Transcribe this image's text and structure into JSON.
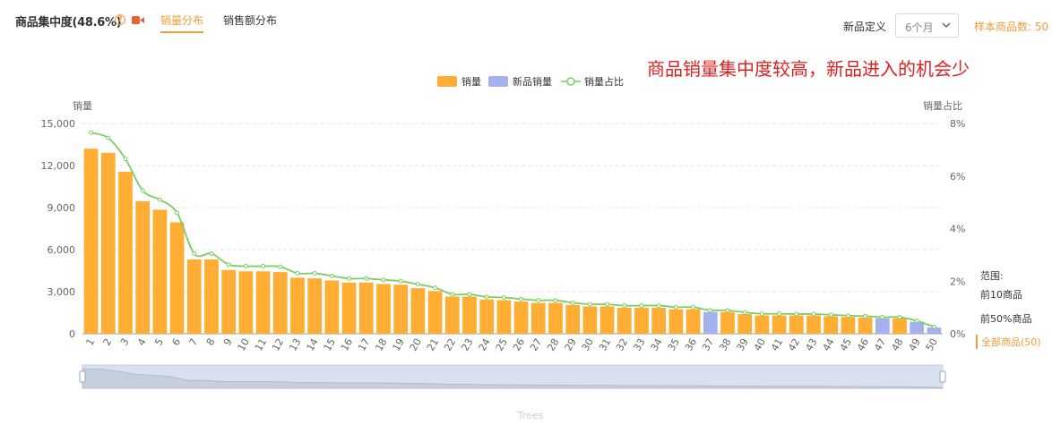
{
  "header": {
    "title": "商品集中度(48.6%)",
    "help_icon": "question-circle-icon",
    "video_icon": "video-camera-icon",
    "tabs": [
      {
        "label": "销量分布",
        "active": true
      },
      {
        "label": "销售额分布",
        "active": false
      }
    ]
  },
  "controls": {
    "new_product_label": "新品定义",
    "period_select": "6个月",
    "sample_count": "样本商品数: 50"
  },
  "annotation": "商品销量集中度较高，新品进入的机会少",
  "range_filter": {
    "title": "范围:",
    "options": [
      "前10商品",
      "前50%商品",
      "全部商品(50)"
    ],
    "selected": "全部商品(50)"
  },
  "colors": {
    "bar": "#ffad33",
    "new_bar": "#a5b0ee",
    "line": "#7ccd62",
    "accent": "#f29c38",
    "annotation": "#e02020"
  },
  "chart_data": {
    "type": "bar",
    "ylabel_left": "销量",
    "ylabel_right": "销量占比",
    "xlabel": "Trees",
    "ylim_left": [
      0,
      15000
    ],
    "yticks_left": [
      "15,000",
      "12,000",
      "9,000",
      "6,000",
      "3,000",
      "0"
    ],
    "ylim_right": [
      0,
      8
    ],
    "yticks_right": [
      "8%",
      "6%",
      "4%",
      "2%",
      "0%"
    ],
    "legend": [
      "销量",
      "新品销量",
      "销量占比"
    ],
    "legend_position": "top-center",
    "grid": true,
    "categories": [
      "1",
      "2",
      "3",
      "4",
      "5",
      "6",
      "7",
      "8",
      "9",
      "10",
      "11",
      "12",
      "13",
      "14",
      "15",
      "16",
      "17",
      "18",
      "19",
      "20",
      "21",
      "22",
      "23",
      "24",
      "25",
      "26",
      "27",
      "28",
      "29",
      "30",
      "31",
      "32",
      "33",
      "34",
      "35",
      "36",
      "37",
      "38",
      "39",
      "40",
      "41",
      "42",
      "43",
      "44",
      "45",
      "46",
      "47",
      "48",
      "49",
      "50"
    ],
    "series": [
      {
        "name": "销量",
        "values": [
          13200,
          12900,
          11550,
          9450,
          8850,
          7950,
          5300,
          5300,
          4550,
          4450,
          4450,
          4400,
          4000,
          3950,
          3800,
          3650,
          3650,
          3550,
          3500,
          3250,
          3050,
          2650,
          2650,
          2450,
          2400,
          2300,
          2200,
          2200,
          2050,
          1950,
          1950,
          1850,
          1850,
          1850,
          1750,
          1750,
          0,
          1550,
          1400,
          1300,
          1300,
          1300,
          1300,
          1250,
          1200,
          1150,
          0,
          1100,
          0,
          0
        ]
      },
      {
        "name": "新品销量",
        "values": [
          0,
          0,
          0,
          0,
          0,
          0,
          0,
          0,
          0,
          0,
          0,
          0,
          0,
          0,
          0,
          0,
          0,
          0,
          0,
          0,
          0,
          0,
          0,
          0,
          0,
          0,
          0,
          0,
          0,
          0,
          0,
          0,
          0,
          0,
          0,
          0,
          1550,
          0,
          0,
          0,
          0,
          0,
          0,
          0,
          0,
          0,
          1100,
          0,
          850,
          450
        ]
      },
      {
        "name": "销量占比",
        "values": [
          7.65,
          7.45,
          6.65,
          5.45,
          5.1,
          4.6,
          3.05,
          3.05,
          2.63,
          2.57,
          2.57,
          2.55,
          2.3,
          2.3,
          2.2,
          2.1,
          2.1,
          2.05,
          2.0,
          1.88,
          1.75,
          1.5,
          1.5,
          1.4,
          1.38,
          1.32,
          1.27,
          1.27,
          1.18,
          1.12,
          1.12,
          1.07,
          1.07,
          1.07,
          1.01,
          1.01,
          0.89,
          0.89,
          0.81,
          0.76,
          0.76,
          0.75,
          0.75,
          0.72,
          0.69,
          0.67,
          0.63,
          0.63,
          0.49,
          0.26
        ]
      }
    ]
  }
}
